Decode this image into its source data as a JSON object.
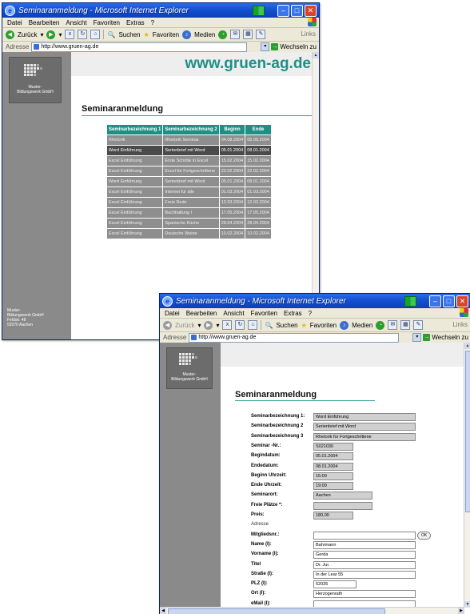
{
  "window1": {
    "title": "Seminaranmeldung - Microsoft Internet Explorer",
    "menu": [
      "Datei",
      "Bearbeiten",
      "Ansicht",
      "Favoriten",
      "Extras",
      "?"
    ],
    "toolbar": {
      "back": "Zurück",
      "search": "Suchen",
      "favorites": "Favoriten",
      "media": "Medien",
      "links": "Links"
    },
    "address": {
      "label": "Adresse",
      "url": "http://www.gruen-ag.de",
      "go": "Wechseln zu"
    },
    "site": {
      "logo_text": [
        "Muster-",
        "Bildungswerk GmbH"
      ],
      "url_heading": "www.gruen-ag.de",
      "page_title": "Seminaranmeldung",
      "footer_address": [
        "Muster-",
        "Bildungswerk GmbH",
        "Feldstr. 48",
        "52070 Aachen"
      ]
    },
    "table": {
      "headers": [
        "Seminarbezeichnung 1",
        "Seminarbezeichnung 2",
        "Beginn",
        "Ende"
      ],
      "rows": [
        [
          "Rhetorik",
          "Rhetorik Seminar",
          "04.08.2004",
          "05.09.2004"
        ],
        [
          "Word Einführung",
          "Serienbrief mit Word",
          "05.01.2004",
          "08.01.2004"
        ],
        [
          "Excel Einführung",
          "Erste Schritte in Excel",
          "15.02.2004",
          "15.02.2004"
        ],
        [
          "Excel Einführung",
          "Excel für Fortgeschrittene",
          "22.02.2004",
          "22.02.2004"
        ],
        [
          "Word Einführung",
          "Serienbrief mit Word",
          "05.01.2004",
          "08.01.2004"
        ],
        [
          "Excel Einführung",
          "Internet für alle",
          "01.03.2004",
          "01.03.2004"
        ],
        [
          "Excel Einführung",
          "Freie Rede",
          "12.03.2004",
          "12.03.2004"
        ],
        [
          "Excel Einführung",
          "Buchhaltung I",
          "17.05.2004",
          "17.05.2004"
        ],
        [
          "Excel Einführung",
          "Spanische Küche",
          "28.04.2004",
          "28.04.2004"
        ],
        [
          "Excel Einführung",
          "Deutsche Weine",
          "10.02.2004",
          "10.02.2004"
        ]
      ],
      "highlight_row": 1
    }
  },
  "window2": {
    "title": "Seminaranmeldung - Microsoft Internet Explorer",
    "menu": [
      "Datei",
      "Bearbeiten",
      "Ansicht",
      "Favoriten",
      "Extras",
      "?"
    ],
    "toolbar": {
      "back": "Zurück",
      "search": "Suchen",
      "favorites": "Favoriten",
      "media": "Medien",
      "links": "Links"
    },
    "address": {
      "label": "Adresse",
      "url": "http://www.gruen-ag.de",
      "go": "Wechseln zu"
    },
    "site": {
      "logo_text": [
        "Muster-",
        "Bildungswerk GmbH"
      ],
      "page_title": "Seminaranmeldung"
    },
    "form": {
      "fields": [
        {
          "label": "Seminarbezeichnung 1:",
          "value": "Word Einführung"
        },
        {
          "label": "Seminarbezeichnung 2",
          "value": "Serienbrief mit Word"
        },
        {
          "label": "Seminarbezeichnung 3",
          "value": "Rhetorik für Fortgeschrittene"
        },
        {
          "label": "Seminar -Nr.:",
          "value": "S021030"
        },
        {
          "label": "Begindatum:",
          "value": "05.01.2004"
        },
        {
          "label": "Endedatum:",
          "value": "08.01.2004"
        },
        {
          "label": "Beginn Uhrzeit:",
          "value": "15:00"
        },
        {
          "label": "Ende Uhrzeit:",
          "value": "19:00"
        },
        {
          "label": "Seminarort:",
          "value": "Aachen"
        },
        {
          "label": "Freie Plätze *:",
          "value": ""
        },
        {
          "label": "Preis:",
          "value": "180,00"
        },
        {
          "label": "Adresse",
          "value": null
        },
        {
          "label": "Mitgliedsnr.:",
          "value": "",
          "button": "OK"
        },
        {
          "label": "Name (I):",
          "value": "Bahrmann"
        },
        {
          "label": "Vorname (I):",
          "value": "Gerda"
        },
        {
          "label": "Titel",
          "value": "Dr. Jur."
        },
        {
          "label": "Straße (I):",
          "value": "In der Lear 55"
        },
        {
          "label": "PLZ (I):",
          "value": "52035"
        },
        {
          "label": "Ort (I):",
          "value": "Herzogenrath"
        },
        {
          "label": "eMail (I):",
          "value": ""
        }
      ]
    }
  }
}
